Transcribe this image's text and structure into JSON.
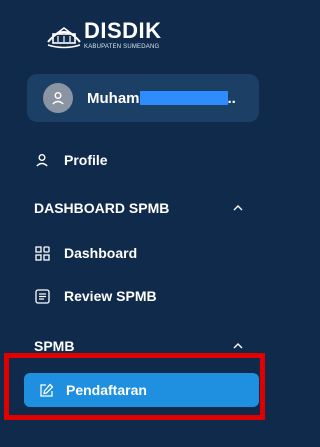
{
  "brand": {
    "title": "DISDIK",
    "subtitle": "KABUPATEN SUMEDANG"
  },
  "user": {
    "name_prefix": "Muham",
    "name_suffix": ".."
  },
  "nav": {
    "profile": {
      "label": "Profile",
      "icon": "user-icon"
    },
    "dashboard_section": {
      "label": "DASHBOARD SPMB",
      "icon": "chevron-up-icon"
    },
    "dashboard": {
      "label": "Dashboard",
      "icon": "dashboard-grid-icon"
    },
    "review": {
      "label": "Review SPMB",
      "icon": "document-list-icon"
    },
    "spmb_section": {
      "label": "SPMB",
      "icon": "chevron-up-icon"
    },
    "pendaftaran": {
      "label": "Pendaftaran",
      "icon": "edit-icon"
    }
  },
  "colors": {
    "sidebar_bg": "#0f2a4a",
    "user_card_bg": "#1c3f66",
    "active_bg": "#1f8fe0",
    "highlight_border": "#e00000",
    "redaction": "#2f8cff"
  }
}
